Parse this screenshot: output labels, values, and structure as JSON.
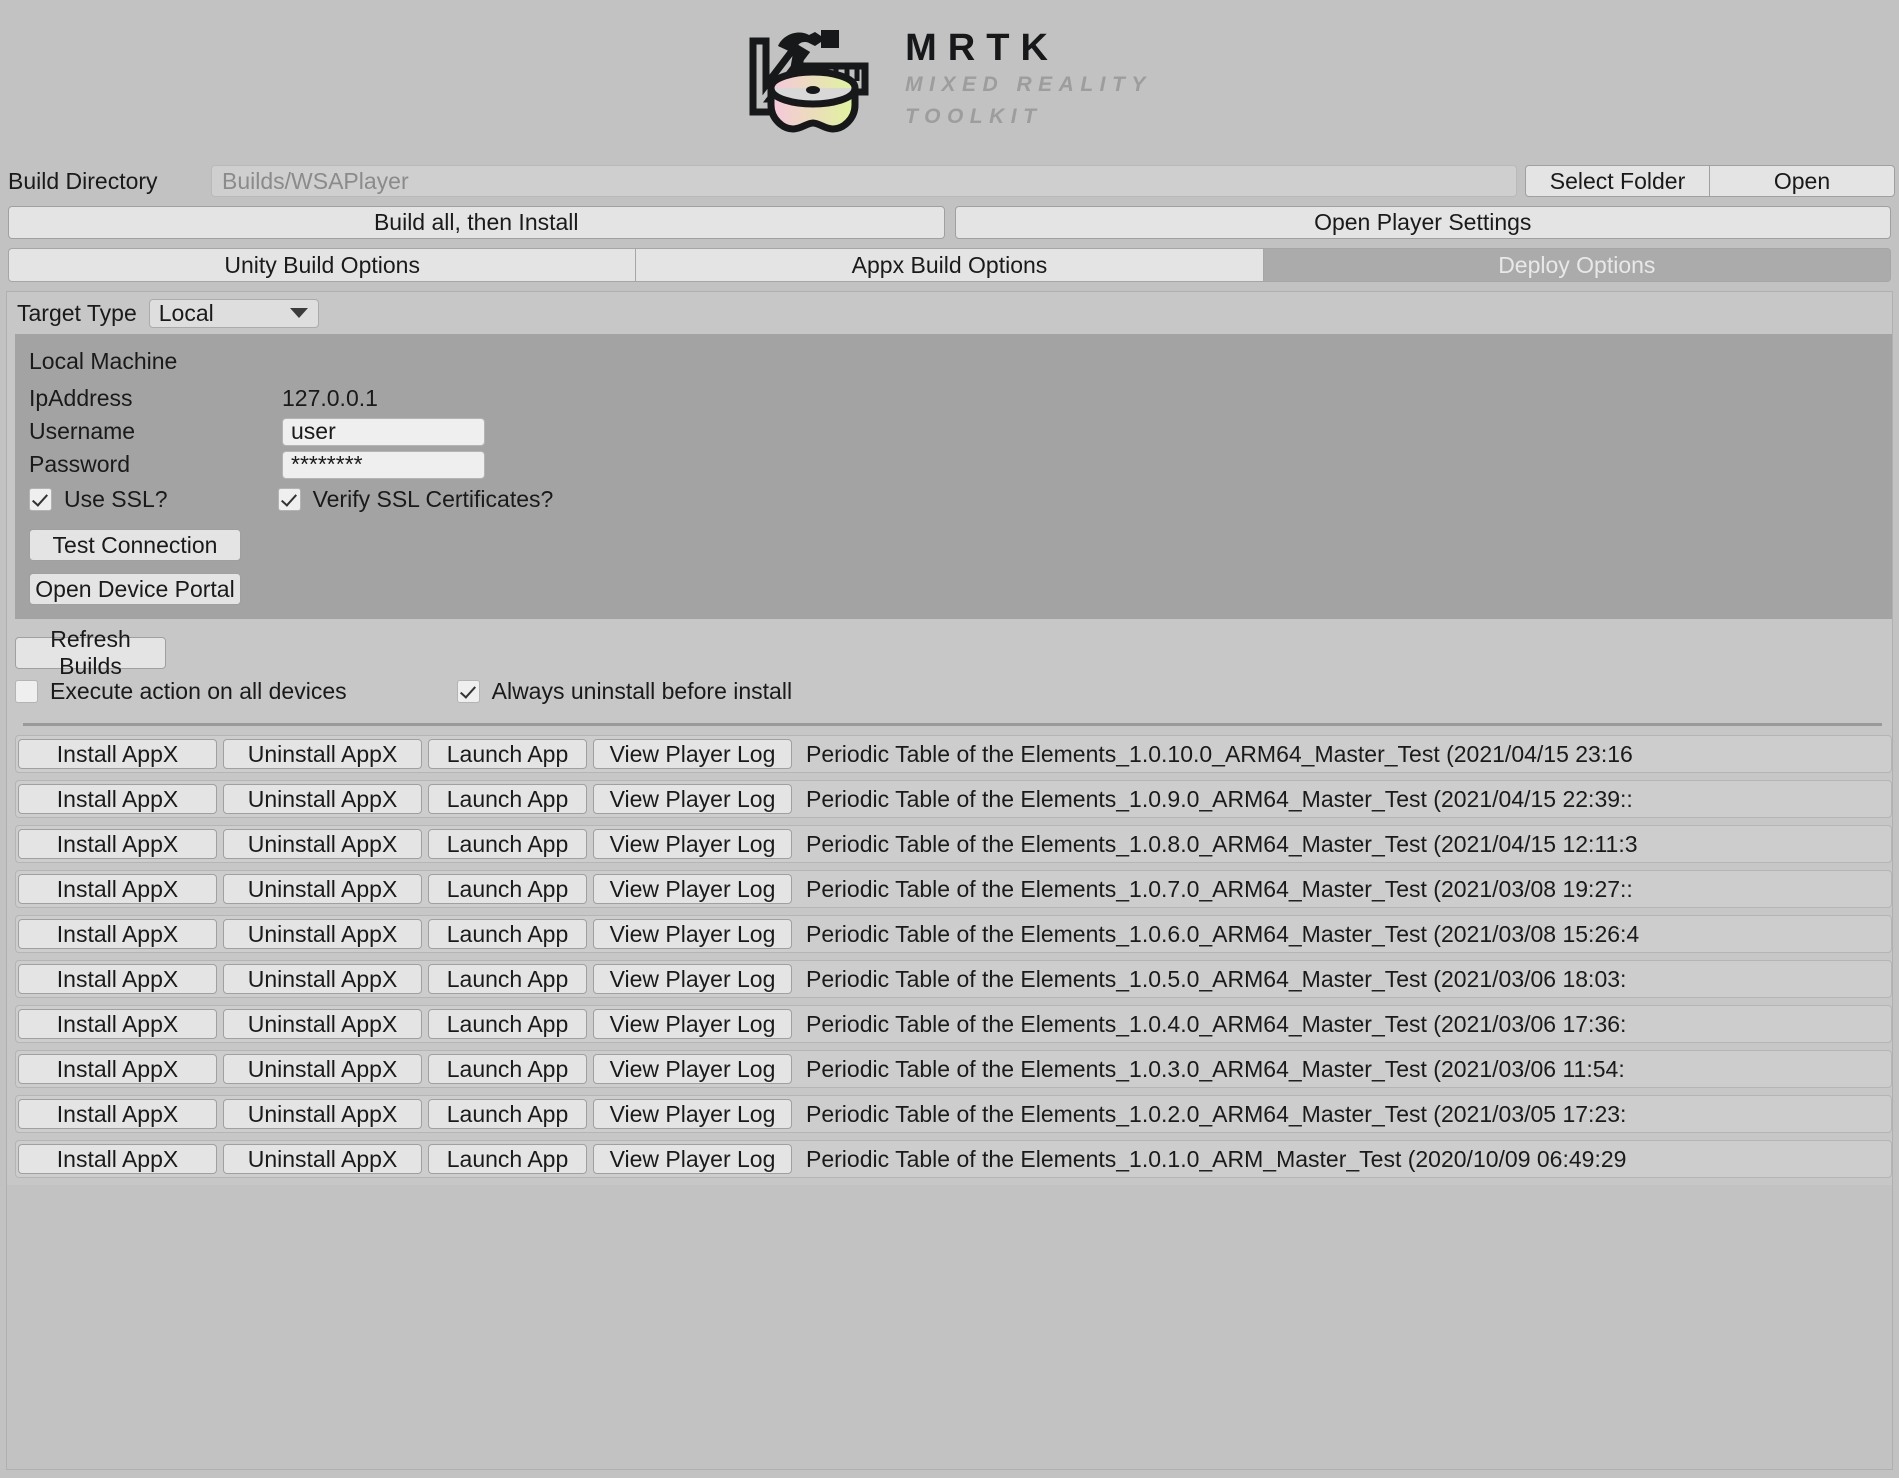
{
  "logo": {
    "title": "MRTK",
    "subtitle_line1": "MIXED REALITY",
    "subtitle_line2": "TOOLKIT",
    "visor_gradient_start": "#f7c6dd",
    "visor_gradient_end": "#dff59a",
    "mark_color": "#17181a"
  },
  "build_directory": {
    "label": "Build Directory",
    "value": "Builds/WSAPlayer",
    "placeholder": "Builds/WSAPlayer",
    "select_folder_label": "Select Folder",
    "open_label": "Open"
  },
  "actions": {
    "build_all_label": "Build all, then Install",
    "open_player_settings_label": "Open Player Settings"
  },
  "tabs": [
    {
      "label": "Unity Build Options",
      "active": false
    },
    {
      "label": "Appx Build Options",
      "active": false
    },
    {
      "label": "Deploy Options",
      "active": true
    }
  ],
  "target": {
    "label": "Target Type",
    "value": "Local"
  },
  "connection": {
    "title": "Local Machine",
    "ip_label": "IpAddress",
    "ip_value": "127.0.0.1",
    "username_label": "Username",
    "username_value": "user",
    "password_label": "Password",
    "password_value": "********",
    "use_ssl_label": "Use SSL?",
    "use_ssl_checked": true,
    "verify_ssl_label": "Verify SSL Certificates?",
    "verify_ssl_checked": true,
    "test_connection_label": "Test Connection",
    "open_device_portal_label": "Open Device Portal"
  },
  "deploy_options": {
    "refresh_builds_label": "Refresh Builds",
    "execute_all_devices_label": "Execute action on all devices",
    "execute_all_devices_checked": false,
    "always_uninstall_label": "Always uninstall before install",
    "always_uninstall_checked": true
  },
  "row_buttons": {
    "install_label": "Install AppX",
    "uninstall_label": "Uninstall AppX",
    "launch_label": "Launch App",
    "view_log_label": "View Player Log"
  },
  "builds": [
    {
      "name": "Periodic Table of the Elements_1.0.10.0_ARM64_Master_Test (2021/04/15 23:16"
    },
    {
      "name": "Periodic Table of the Elements_1.0.9.0_ARM64_Master_Test (2021/04/15 22:39::"
    },
    {
      "name": "Periodic Table of the Elements_1.0.8.0_ARM64_Master_Test (2021/04/15 12:11:3"
    },
    {
      "name": "Periodic Table of the Elements_1.0.7.0_ARM64_Master_Test (2021/03/08 19:27::"
    },
    {
      "name": "Periodic Table of the Elements_1.0.6.0_ARM64_Master_Test (2021/03/08 15:26:4"
    },
    {
      "name": "Periodic Table of the Elements_1.0.5.0_ARM64_Master_Test (2021/03/06 18:03:"
    },
    {
      "name": "Periodic Table of the Elements_1.0.4.0_ARM64_Master_Test (2021/03/06 17:36:"
    },
    {
      "name": "Periodic Table of the Elements_1.0.3.0_ARM64_Master_Test (2021/03/06 11:54:"
    },
    {
      "name": "Periodic Table of the Elements_1.0.2.0_ARM64_Master_Test (2021/03/05 17:23:"
    },
    {
      "name": "Periodic Table of the Elements_1.0.1.0_ARM_Master_Test (2020/10/09 06:49:29"
    }
  ]
}
